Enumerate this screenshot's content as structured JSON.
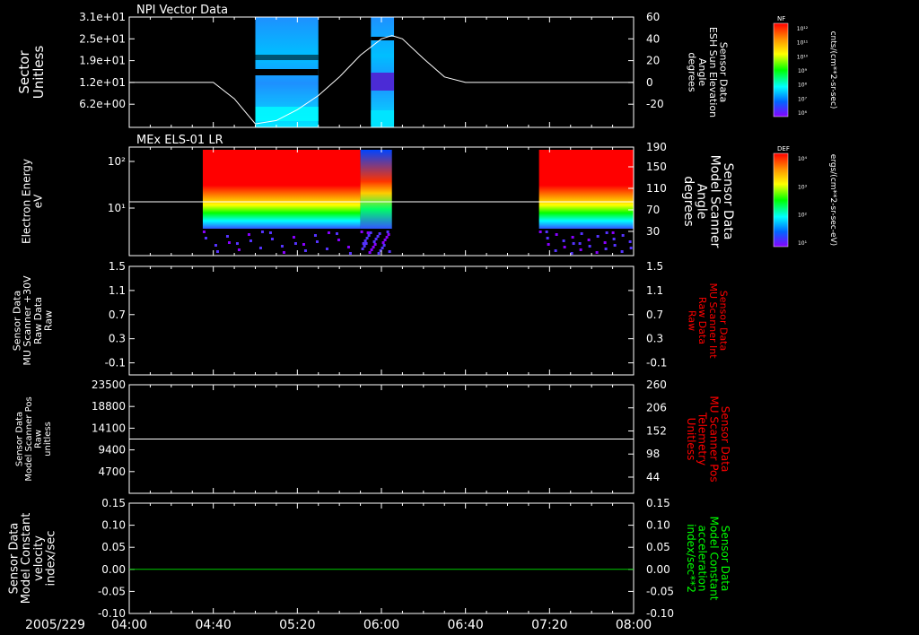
{
  "footer": {
    "date": "2005/229",
    "time_ticks": [
      "04:00",
      "04:40",
      "05:20",
      "06:00",
      "06:40",
      "07:20",
      "08:00"
    ]
  },
  "colors": {
    "background": "#000000",
    "axis": "#ffffff",
    "red_label": "#ff0000",
    "green_label": "#00ff00",
    "trace_white": "#ffffff",
    "trace_green": "#00cc00"
  },
  "chart_data": [
    {
      "type": "heatmap",
      "panel_title": "NPI Vector Data",
      "ylabel_left": [
        "Sector",
        "Unitless"
      ],
      "yticks_left": [
        "3.1e+01",
        "2.5e+01",
        "1.9e+01",
        "1.2e+01",
        "6.2e+00"
      ],
      "ylabel_right": [
        "Sensor Data",
        "ESH Sun Elevation",
        "Angle",
        "degrees"
      ],
      "yticks_right": [
        "60",
        "40",
        "20",
        "0",
        "-20"
      ],
      "ylim_right": [
        -40,
        60
      ],
      "colorbar": {
        "title": "NF",
        "unit": "cnts/(cm**2-sr-sec)",
        "ticks": [
          "10¹²",
          "10¹¹",
          "10¹⁰",
          "10⁹",
          "10⁸",
          "10⁷",
          "10⁶"
        ]
      },
      "data_blocks_time": [
        [
          "05:00",
          "05:30"
        ],
        [
          "05:55",
          "06:06"
        ]
      ],
      "line_series": {
        "time": [
          "04:00",
          "04:40",
          "04:50",
          "05:00",
          "05:10",
          "05:20",
          "05:30",
          "05:40",
          "05:50",
          "06:00",
          "06:05",
          "06:10",
          "06:20",
          "06:30",
          "06:40",
          "07:00",
          "07:20",
          "08:00"
        ],
        "values": [
          0,
          0,
          -15,
          -38,
          -35,
          -25,
          -12,
          5,
          25,
          40,
          43,
          40,
          22,
          5,
          0,
          0,
          0,
          0
        ]
      }
    },
    {
      "type": "heatmap",
      "panel_title": "MEx ELS-01 LR",
      "ylabel_left": [
        "Electron Energy",
        "eV"
      ],
      "yticks_left": [
        "10²",
        "10¹"
      ],
      "ylabel_right": [
        "Sensor Data",
        "Model Scanner",
        "Angle",
        "degrees"
      ],
      "yticks_right": [
        "190",
        "150",
        "110",
        "70",
        "30"
      ],
      "ylim_right": [
        10,
        190
      ],
      "colorbar": {
        "title": "DEF",
        "unit": "ergs/(cm**2-sr-sec-eV)",
        "ticks": [
          "10⁴",
          "10³",
          "10²",
          "10¹"
        ]
      },
      "data_blocks_time": [
        [
          "04:35",
          "05:50"
        ],
        [
          "05:50",
          "06:05"
        ],
        [
          "07:15",
          "08:00"
        ]
      ],
      "line_series": {
        "time": [
          "04:00",
          "08:00"
        ],
        "values": [
          90,
          90
        ]
      }
    },
    {
      "type": "line",
      "ylabel_left": [
        "Sensor Data",
        "MU Scanner +30V",
        "Raw Data",
        "Raw"
      ],
      "yticks_left": [
        "1.5",
        "1.1",
        "0.7",
        "0.3",
        "-0.1"
      ],
      "ylabel_right": [
        "Sensor Data",
        "MU Scanner Int",
        "Raw Data",
        "Raw"
      ],
      "yticks_right": [
        "1.5",
        "1.1",
        "0.7",
        "0.3",
        "-0.1"
      ],
      "ylim": [
        -0.3,
        1.5
      ]
    },
    {
      "type": "line",
      "ylabel_left": [
        "Sensor Data",
        "Model Scanner Pos",
        "Raw",
        "unitless"
      ],
      "yticks_left": [
        "23500",
        "18800",
        "14100",
        "9400",
        "4700"
      ],
      "ylabel_right": [
        "Sensor Data",
        "MU Scanner Pos",
        "Telemetry",
        "Unitless"
      ],
      "yticks_right": [
        "260",
        "206",
        "152",
        "98",
        "44"
      ],
      "ylim": [
        0,
        23500
      ],
      "line_series": {
        "time": [
          "04:00",
          "08:00"
        ],
        "values": [
          11750,
          11750
        ]
      }
    },
    {
      "type": "line",
      "ylabel_left": [
        "Sensor Data",
        "Model Constant",
        "velocity",
        "index/sec"
      ],
      "yticks_left": [
        "0.15",
        "0.10",
        "0.05",
        "0.00",
        "-0.05",
        "-0.10"
      ],
      "ylabel_right": [
        "Sensor Data",
        "Model Constant",
        "acceleration",
        "index/sec**2"
      ],
      "yticks_right": [
        "0.15",
        "0.10",
        "0.05",
        "0.00",
        "-0.05",
        "-0.10"
      ],
      "ylim": [
        -0.1,
        0.15
      ],
      "line_series": {
        "time": [
          "04:00",
          "08:00"
        ],
        "values": [
          0,
          0
        ]
      }
    }
  ]
}
